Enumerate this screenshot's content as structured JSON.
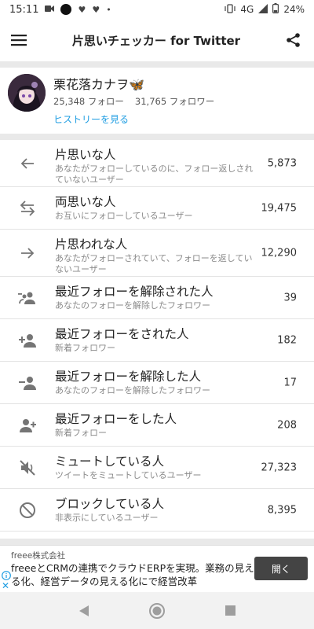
{
  "status_bar": {
    "time": "15:11",
    "network": "4G",
    "battery": "24%"
  },
  "app_bar": {
    "title": "片思いチェッカー for Twitter",
    "menu_icon": "hamburger-menu-icon",
    "share_icon": "share-icon"
  },
  "profile": {
    "name": "栗花落カナヲ",
    "name_emoji": "🦋",
    "following": "25,348 フォロー",
    "followers": "31,765 フォロワー",
    "history_link": "ヒストリーを見る"
  },
  "list": {
    "items": [
      {
        "label": "片思いな人",
        "desc": "あなたがフォローしているのに、フォロー返しされていないユーザー",
        "count": "5,873",
        "icon": "arrow-left-icon"
      },
      {
        "label": "両思いな人",
        "desc": "お互いにフォローしているユーザー",
        "count": "19,475",
        "icon": "swap-arrows-icon"
      },
      {
        "label": "片思われな人",
        "desc": "あなたがフォローされていて、フォローを返していないユーザー",
        "count": "12,290",
        "icon": "arrow-right-icon"
      },
      {
        "label": "最近フォローを解除された人",
        "desc": "あなたのフォローを解除したフォロワー",
        "count": "39",
        "icon": "group-remove-icon"
      },
      {
        "label": "最近フォローをされた人",
        "desc": "新着フォロワー",
        "count": "182",
        "icon": "person-add-icon"
      },
      {
        "label": "最近フォローを解除した人",
        "desc": "あなたのフォローを解除したフォロワー",
        "count": "17",
        "icon": "person-remove-icon"
      },
      {
        "label": "最近フォローをした人",
        "desc": "新着フォロー",
        "count": "208",
        "icon": "person-add-outline-icon"
      },
      {
        "label": "ミュートしている人",
        "desc": "ツイートをミュートしているユーザー",
        "count": "27,323",
        "icon": "volume-off-icon"
      },
      {
        "label": "ブロックしている人",
        "desc": "非表示にしているユーザー",
        "count": "8,395",
        "icon": "block-icon"
      }
    ]
  },
  "ad": {
    "sponsor": "freee株式会社",
    "text": "freeeとCRMの連携でクラウドERPを実現。業務の見える化、経営データの見える化にで経営改革",
    "open_label": "開く"
  },
  "colors": {
    "link": "#1e9de2",
    "icon": "#757575",
    "divider": "#e9e9e9"
  }
}
